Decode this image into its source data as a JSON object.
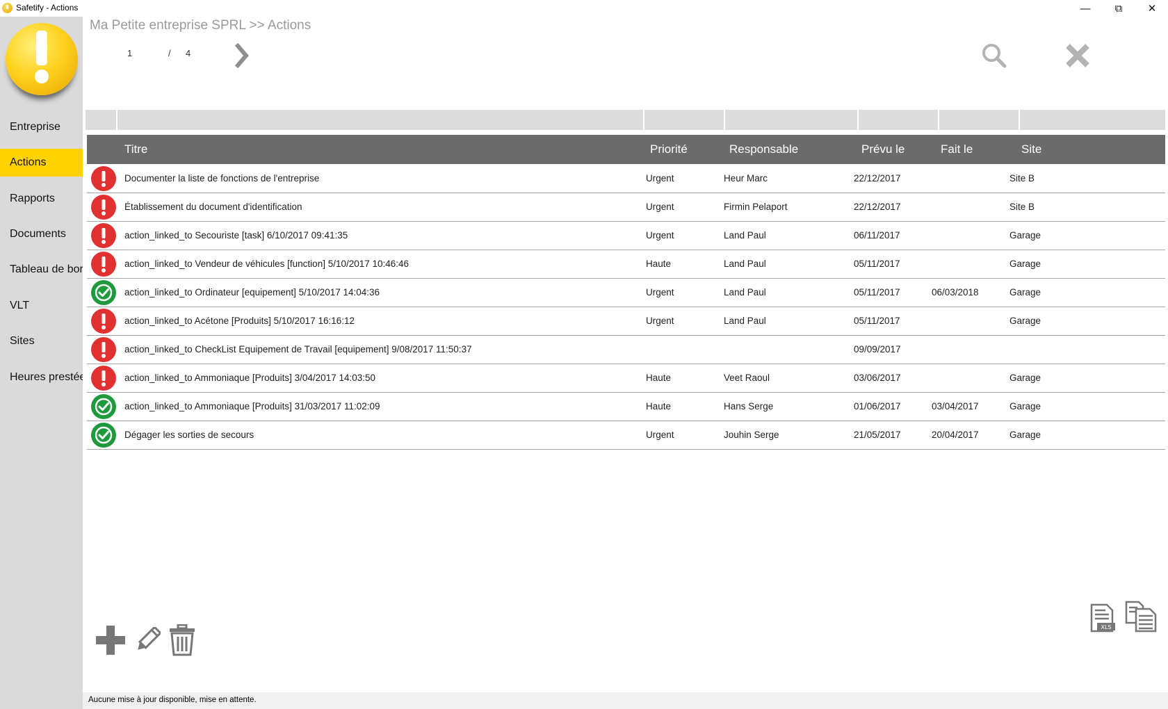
{
  "window": {
    "title": "Safetify - Actions",
    "controls": {
      "minimize": "—",
      "restore": "⧉",
      "close": "✕"
    }
  },
  "sidebar": {
    "items": [
      {
        "label": "Entreprise",
        "active": false
      },
      {
        "label": "Actions",
        "active": true
      },
      {
        "label": "Rapports",
        "active": false
      },
      {
        "label": "Documents",
        "active": false
      },
      {
        "label": "Tableau de bord",
        "active": false
      },
      {
        "label": "VLT",
        "active": false
      },
      {
        "label": "Sites",
        "active": false
      },
      {
        "label": "Heures prestées",
        "active": false
      }
    ]
  },
  "header": {
    "breadcrumb": "Ma Petite entreprise SPRL >> Actions",
    "pagination": {
      "current": "1",
      "separator": "/",
      "total": "4"
    }
  },
  "table": {
    "columns": [
      "",
      "Titre",
      "Priorité",
      "Responsable",
      "Prévu le",
      "Fait le",
      "Site"
    ],
    "rows": [
      {
        "status": "open",
        "title": "Documenter la liste de fonctions de l'entreprise",
        "priority": "Urgent",
        "responsible": "Heur Marc",
        "planned": "22/12/2017",
        "done": "",
        "site": "Site B"
      },
      {
        "status": "open",
        "title": "Établissement du document d'identification",
        "priority": "Urgent",
        "responsible": "Firmin Pelaport",
        "planned": "22/12/2017",
        "done": "",
        "site": "Site B"
      },
      {
        "status": "open",
        "title": "action_linked_to Secouriste [task]  6/10/2017 09:41:35",
        "priority": "Urgent",
        "responsible": "Land Paul",
        "planned": "06/11/2017",
        "done": "",
        "site": "Garage"
      },
      {
        "status": "open",
        "title": "action_linked_to Vendeur de véhicules [function]  5/10/2017 10:46:46",
        "priority": "Haute",
        "responsible": "Land Paul",
        "planned": "05/11/2017",
        "done": "",
        "site": "Garage"
      },
      {
        "status": "done",
        "title": "action_linked_to Ordinateur [equipement]  5/10/2017 14:04:36",
        "priority": "Urgent",
        "responsible": "Land Paul",
        "planned": "05/11/2017",
        "done": "06/03/2018",
        "site": "Garage"
      },
      {
        "status": "open",
        "title": "action_linked_to Acétone [Produits]  5/10/2017 16:16:12",
        "priority": "Urgent",
        "responsible": "Land Paul",
        "planned": "05/11/2017",
        "done": "",
        "site": "Garage"
      },
      {
        "status": "open",
        "title": "action_linked_to CheckList Equipement de Travail  [equipement]  9/08/2017 11:50:37",
        "priority": "",
        "responsible": "",
        "planned": "09/09/2017",
        "done": "",
        "site": ""
      },
      {
        "status": "open",
        "title": "action_linked_to Ammoniaque [Produits]  3/04/2017 14:03:50",
        "priority": "Haute",
        "responsible": "Veet Raoul",
        "planned": "03/06/2017",
        "done": "",
        "site": "Garage"
      },
      {
        "status": "done",
        "title": "action_linked_to Ammoniaque [Produits]  31/03/2017 11:02:09",
        "priority": "Haute",
        "responsible": "Hans Serge",
        "planned": "01/06/2017",
        "done": "03/04/2017",
        "site": "Garage"
      },
      {
        "status": "done",
        "title": "Dégager les sorties de secours",
        "priority": "Urgent",
        "responsible": "Jouhin Serge",
        "planned": "21/05/2017",
        "done": "20/04/2017",
        "site": "Garage"
      }
    ]
  },
  "icons": {
    "open": "exclamation-icon",
    "done": "checkmark-icon",
    "search": "search-icon",
    "close": "close-icon",
    "next": "chevron-right-icon",
    "add": "plus-icon",
    "edit": "pencil-icon",
    "delete": "trash-icon",
    "export_xls": "xls-export-icon",
    "export_doc": "document-export-icon"
  },
  "colors": {
    "accent": "#ffd200",
    "status_open": "#e03030",
    "status_done": "#1e9a3c",
    "header_bg": "#6b6b6b",
    "sidebar_bg": "#dadada"
  },
  "statusbar": {
    "text": "Aucune mise à jour disponible, mise en attente."
  }
}
